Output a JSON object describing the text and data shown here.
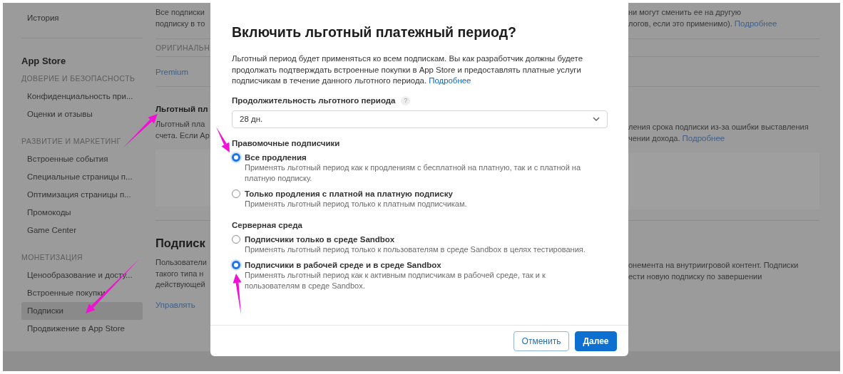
{
  "sidebar": {
    "top_item": {
      "label": "История",
      "selected": false
    },
    "heading": "App Store",
    "sections": [
      {
        "label": "ДОВЕРИЕ И БЕЗОПАСНОСТЬ",
        "items": [
          {
            "label": "Конфиденциальность при...",
            "selected": false
          },
          {
            "label": "Оценки и отзывы",
            "selected": false
          }
        ]
      },
      {
        "label": "РАЗВИТИЕ И МАРКЕТИНГ",
        "items": [
          {
            "label": "Встроенные события",
            "selected": false
          },
          {
            "label": "Специальные страницы п...",
            "selected": false
          },
          {
            "label": "Оптимизация страницы п...",
            "selected": false
          },
          {
            "label": "Промокоды",
            "selected": false
          },
          {
            "label": "Game Center",
            "selected": false
          }
        ]
      },
      {
        "label": "МОНЕТИЗАЦИЯ",
        "items": [
          {
            "label": "Ценообразование и досту...",
            "selected": false
          },
          {
            "label": "Встроенные покупки",
            "selected": false
          },
          {
            "label": "Подписки",
            "selected": true
          },
          {
            "label": "Продвижение в App Store",
            "selected": false
          }
        ]
      }
    ]
  },
  "background": {
    "intro": {
      "left": [
        "Все подписки",
        "подписку в то"
      ],
      "right": [
        "ни могут сменить ее на другую",
        "логов, если это применимо)."
      ],
      "right_link": "Подробнее"
    },
    "column_header": "ОРИГИНАЛЬН",
    "row_link": "Premium",
    "grace": {
      "title": "Льготный пл",
      "left": [
        "Льготный пла",
        "счета. Если Ap"
      ],
      "right": [
        "ления срока подписки из-за ошибки выставления",
        "чении дохода."
      ],
      "right_link": "Подробнее"
    },
    "subscriptions": {
      "title": "Подписк",
      "left": [
        "Пользователи",
        "такого типа н",
        "действующей"
      ],
      "right": [
        "онемента на внутриигровой контент. Подписки",
        "ести новую подписку по завершении"
      ],
      "link": "Управлять"
    }
  },
  "dialog": {
    "title": "Включить льготный платежный период?",
    "description": "Льготный период будет применяться ко всем подпискам. Вы как разработчик должны будете продолжать подтверждать встроенные покупки в App Store и предоставлять платные услуги подписчикам в течение данного льготного периода.",
    "description_link": "Подробнее",
    "duration": {
      "label": "Продолжительность льготного периода",
      "help": "?",
      "value": "28 дн."
    },
    "groups": [
      {
        "label": "Правомочные подписчики",
        "options": [
          {
            "label": "Все продления",
            "description": "Применять льготный период как к продлениям с бесплатной на платную, так и с платной на платную подписку.",
            "selected": true
          },
          {
            "label": "Только продления с платной на платную подписку",
            "description": "Применять льготный период только к платным подписчикам.",
            "selected": false
          }
        ]
      },
      {
        "label": "Серверная среда",
        "options": [
          {
            "label": "Подписчики только в среде Sandbox",
            "description": "Применять льготный период только к пользователям в среде Sandbox в целях тестирования.",
            "selected": false
          },
          {
            "label": "Подписчики в рабочей среде и в среде Sandbox",
            "description": "Применять льготный период как к активным подписчикам в рабочей среде, так и к пользователям в среде Sandbox.",
            "selected": true
          }
        ]
      }
    ],
    "buttons": [
      {
        "label": "Отменить",
        "kind": "secondary"
      },
      {
        "label": "Далее",
        "kind": "primary"
      }
    ]
  }
}
